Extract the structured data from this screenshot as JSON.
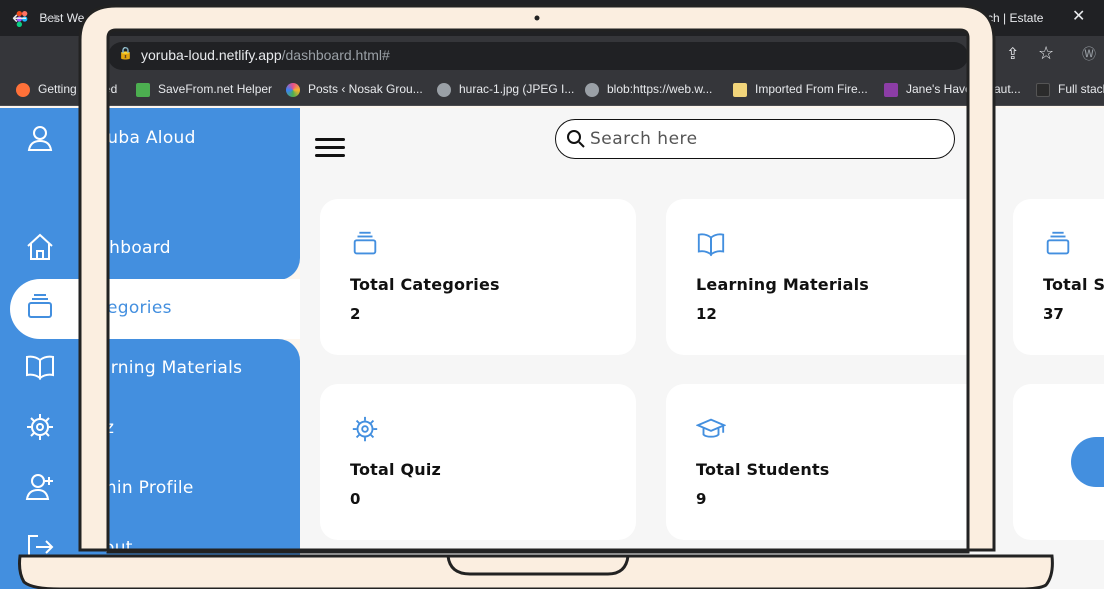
{
  "browser": {
    "tabs": [
      {
        "title": "Best We"
      },
      {
        "title": "Arch | Estate"
      }
    ],
    "url": {
      "host": "yoruba-loud.netlify.app",
      "path": "/dashboard.html#"
    },
    "bookmarks": [
      {
        "label": "Getting",
        "icon": "firefox-icon",
        "color": "#ff7139"
      },
      {
        "label": "ed",
        "icon": "",
        "color": ""
      },
      {
        "label": "SaveFrom.net Helper",
        "icon": "download-arrow-icon",
        "color": "#4caf50"
      },
      {
        "label": "Posts ‹ Nosak Grou...",
        "icon": "colorful-circle-icon",
        "color": "#e84f8a"
      },
      {
        "label": "hurac-1.jpg (JPEG I...",
        "icon": "globe-icon",
        "color": "#9aa0a6"
      },
      {
        "label": "blob:https://web.w...",
        "icon": "globe-icon",
        "color": "#9aa0a6"
      },
      {
        "label": "Imported From Fire...",
        "icon": "folder-icon",
        "color": "#f1d47a"
      },
      {
        "label": "Jane's Have",
        "icon": "bookmark-icon",
        "color": "#8c3da6"
      },
      {
        "label": "aut...",
        "icon": "",
        "color": ""
      },
      {
        "label": "Full stack",
        "icon": "page-icon",
        "color": "#2b2b2b"
      }
    ]
  },
  "app": {
    "brand": "ruba Aloud",
    "nav": [
      {
        "label": "shboard",
        "icon": "home-icon"
      },
      {
        "label": "tegories",
        "icon": "layers-icon",
        "active": true
      },
      {
        "label": "arning Materials",
        "icon": "book-icon"
      },
      {
        "label": "iz",
        "icon": "gear-icon"
      },
      {
        "label": "min Profile",
        "icon": "add-user-icon"
      },
      {
        "label": "out",
        "icon": "logout-icon"
      }
    ],
    "search": {
      "placeholder": "Search here"
    },
    "cards": [
      {
        "title": "Total Categories",
        "value": "2",
        "icon": "layers-icon"
      },
      {
        "title": "Learning Materials",
        "value": "12",
        "icon": "book-icon"
      },
      {
        "title": "Total S",
        "value": "37",
        "icon": "layers-icon"
      },
      {
        "title": "Total Quiz",
        "value": "0",
        "icon": "gear-icon"
      },
      {
        "title": "Total Students",
        "value": "9",
        "icon": "graduation-cap-icon"
      }
    ]
  },
  "colors": {
    "accent": "#438fdf",
    "frame": "#fbeee0",
    "frame_outline": "#222222"
  }
}
